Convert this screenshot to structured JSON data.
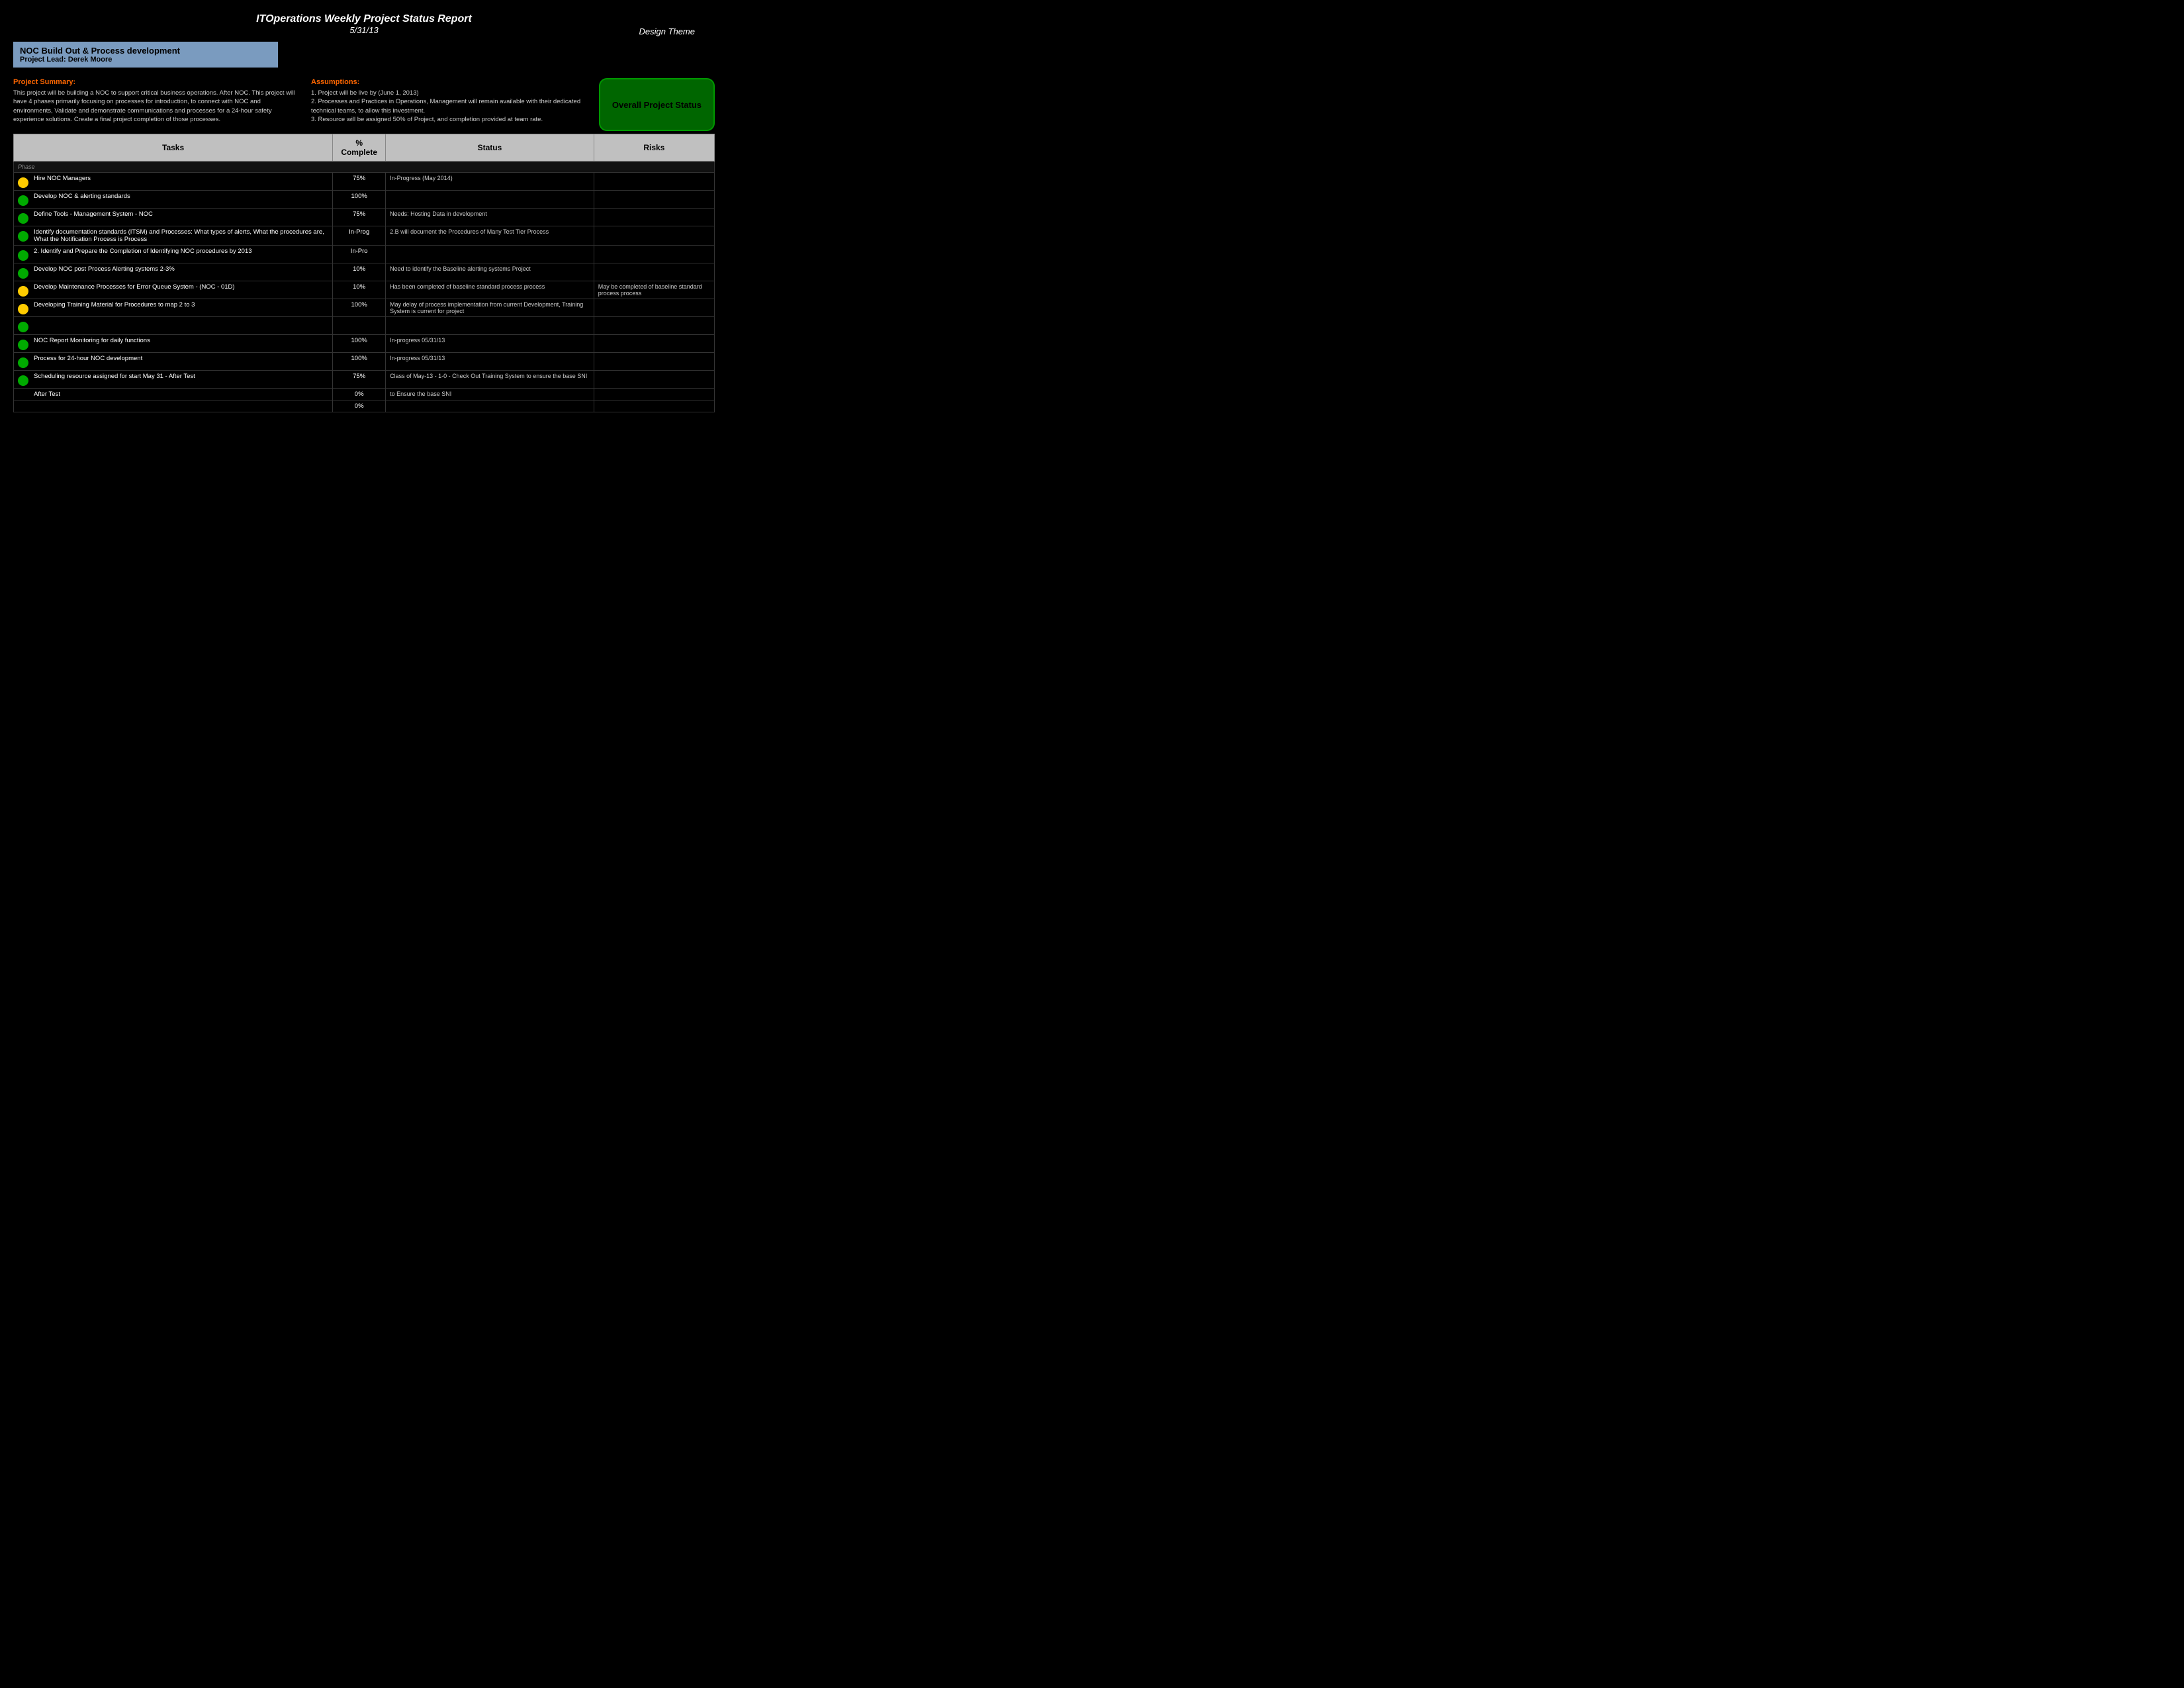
{
  "header": {
    "title": "ITOperations Weekly Project Status Report",
    "subtitle": "5/31/13",
    "logo": "Design Theme"
  },
  "project": {
    "name": "NOC Build Out & Process development",
    "lead_label": "Project Lead:",
    "lead_name": "Derek Moore"
  },
  "project_summary": {
    "title": "Project Summary:",
    "text": "This project will be building a NOC to support critical business operations. After NOC. This project will have 4 phases primarily focusing on processes for introduction, to connect with NOC and environments, Validate and demonstrate communications and processes for a 24-hour safety experience solutions. Create a final project completion of those processes."
  },
  "assumptions": {
    "title": "Assumptions:",
    "items": [
      "1. Project will be live by (June 1, 2013)",
      "2. Processes and Practices in Operations, Management will remain available with their dedicated technical teams, to allow this investment.",
      "3. Resource will be assigned 50% of Project, and completion provided at team rate."
    ]
  },
  "overall_status": {
    "label": "Overall Project Status"
  },
  "table": {
    "columns": [
      "Tasks",
      "% Complete",
      "Status",
      "Risks"
    ],
    "rows": [
      {
        "group": true,
        "label": "Phase",
        "dot": null,
        "task": "Phase",
        "pct": "",
        "status": "",
        "risks": ""
      },
      {
        "dot": "yellow",
        "task": "Hire NOC Managers",
        "pct": "75%",
        "status": "In-Progress (May 2014)",
        "risks": ""
      },
      {
        "dot": "green",
        "task": "Develop NOC & alerting standards",
        "pct": "100%",
        "status": "",
        "risks": ""
      },
      {
        "dot": "green",
        "task": "Define Tools - Management System - NOC",
        "pct": "75%",
        "status": "Needs: Hosting Data in development",
        "risks": ""
      },
      {
        "dot": "green",
        "task": "Identify documentation standards (ITSM) and Processes: What types of alerts, What the procedures are, What the Notification Process is Process",
        "pct": "In-Prog",
        "status": "2.B will document the Procedures of Many Test Tier Process",
        "risks": ""
      },
      {
        "dot": "green",
        "task": "2. Identify and Prepare the Completion of Identifying NOC procedures by 2013",
        "pct": "In-Pro",
        "status": "",
        "risks": ""
      },
      {
        "dot": "green",
        "task": "Develop NOC post Process Alerting systems 2-3%",
        "pct": "10%",
        "status": "Need to identify the Baseline alerting systems Project",
        "risks": ""
      },
      {
        "dot": "yellow",
        "task": "Develop Maintenance Processes for Error Queue System - (NOC - 01D)",
        "pct": "10%",
        "status": "Has been completed of baseline standard process process",
        "risks": "May be completed of baseline standard process process"
      },
      {
        "dot": "yellow",
        "task": "Developing Training Material for Procedures to map 2 to 3",
        "pct": "100%",
        "status": "May delay of process implementation from current Development, Training System is current for project",
        "risks": ""
      },
      {
        "dot": "green",
        "task": "",
        "pct": "",
        "status": "",
        "risks": ""
      },
      {
        "dot": "green",
        "task": "NOC Report Monitoring for daily functions",
        "pct": "100%",
        "status": "In-progress 05/31/13",
        "risks": ""
      },
      {
        "dot": "green",
        "task": "Process for 24-hour NOC development",
        "pct": "100%",
        "status": "In-progress 05/31/13",
        "risks": ""
      },
      {
        "dot": "green",
        "task": "Scheduling resource assigned for start May 31 - After Test",
        "pct": "75%",
        "status": "Class of May-13 - 1-0 - Check Out Training System to ensure the base SNI",
        "risks": ""
      },
      {
        "dot": null,
        "task": "After Test",
        "pct": "0%",
        "status": "to Ensure the base SNI",
        "risks": ""
      },
      {
        "dot": null,
        "task": "",
        "pct": "0%",
        "status": "",
        "risks": ""
      }
    ]
  }
}
